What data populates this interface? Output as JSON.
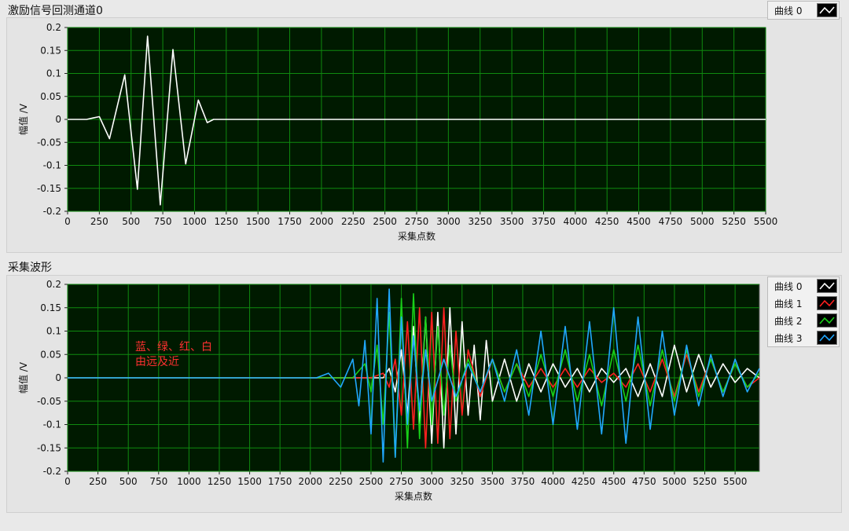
{
  "chart_data": [
    {
      "type": "line",
      "title": "激励信号回测通道0",
      "xlabel": "采集点数",
      "ylabel": "幅值 /V",
      "xlim": [
        0,
        5500
      ],
      "ylim": [
        -0.2,
        0.2
      ],
      "xticks": [
        0,
        250,
        500,
        750,
        1000,
        1250,
        1500,
        1750,
        2000,
        2250,
        2500,
        2750,
        3000,
        3250,
        3500,
        3750,
        4000,
        4250,
        4500,
        4750,
        5000,
        5250,
        5500
      ],
      "yticks": [
        0.2,
        0.15,
        0.1,
        0.05,
        0,
        -0.05,
        -0.1,
        -0.15,
        -0.2
      ],
      "grid": true,
      "legend": "top-right",
      "series": [
        {
          "name": "曲线 0",
          "color": "#ffffff",
          "x": [
            0,
            150,
            200,
            250,
            330,
            450,
            550,
            630,
            730,
            830,
            930,
            1030,
            1100,
            1150,
            1200,
            5500
          ],
          "y": [
            0,
            0,
            0.003,
            0.006,
            -0.042,
            0.097,
            -0.152,
            0.181,
            -0.186,
            0.152,
            -0.097,
            0.042,
            -0.007,
            0,
            0,
            0
          ]
        }
      ]
    },
    {
      "type": "line",
      "title": "采集波形",
      "xlabel": "采集点数",
      "ylabel": "幅值 /V",
      "xlim": [
        0,
        5700
      ],
      "ylim": [
        -0.2,
        0.2
      ],
      "xticks": [
        0,
        250,
        500,
        750,
        1000,
        1250,
        1500,
        1750,
        2000,
        2250,
        2500,
        2750,
        3000,
        3250,
        3500,
        3750,
        4000,
        4250,
        4500,
        4750,
        5000,
        5250,
        5500
      ],
      "yticks": [
        0.2,
        0.15,
        0.1,
        0.05,
        0,
        -0.05,
        -0.1,
        -0.15,
        -0.2
      ],
      "grid": true,
      "legend": "top-right",
      "annotation": [
        "蓝、绿、红、白",
        "由远及近"
      ],
      "annotation_color": "#ff3030",
      "series": [
        {
          "name": "曲线 0",
          "color": "#ffffff",
          "x": [
            0,
            2000,
            2600,
            2650,
            2700,
            2750,
            2800,
            2850,
            2900,
            2950,
            3000,
            3050,
            3100,
            3150,
            3200,
            3250,
            3300,
            3350,
            3400,
            3450,
            3500,
            3600,
            3700,
            3800,
            3900,
            4000,
            4100,
            4200,
            4300,
            4400,
            4500,
            4600,
            4700,
            4800,
            4900,
            5000,
            5100,
            5200,
            5300,
            5400,
            5500,
            5600,
            5700
          ],
          "y": [
            0,
            0,
            0,
            0.02,
            -0.03,
            0.06,
            -0.08,
            0.11,
            -0.1,
            0.13,
            -0.14,
            0.14,
            -0.15,
            0.15,
            -0.12,
            0.12,
            -0.08,
            0.07,
            -0.09,
            0.08,
            -0.05,
            0.04,
            -0.05,
            0.03,
            -0.03,
            0.03,
            -0.02,
            0.02,
            -0.03,
            0.02,
            -0.01,
            0.02,
            -0.04,
            0.03,
            -0.04,
            0.07,
            -0.03,
            0.05,
            -0.02,
            0.03,
            -0.01,
            0.02,
            0
          ]
        },
        {
          "name": "曲线 1",
          "color": "#ff2020",
          "x": [
            0,
            2200,
            2500,
            2600,
            2650,
            2700,
            2750,
            2800,
            2850,
            2900,
            2950,
            3000,
            3050,
            3100,
            3150,
            3200,
            3250,
            3300,
            3400,
            3500,
            3600,
            3700,
            3800,
            3900,
            4000,
            4100,
            4200,
            4300,
            4400,
            4500,
            4600,
            4700,
            4800,
            4900,
            5000,
            5100,
            5200,
            5300,
            5400,
            5500,
            5600,
            5700
          ],
          "y": [
            0,
            0,
            0,
            0.01,
            -0.02,
            0.04,
            -0.08,
            0.12,
            -0.11,
            0.15,
            -0.15,
            0.14,
            -0.14,
            0.15,
            -0.13,
            0.1,
            -0.08,
            0.06,
            -0.04,
            0.04,
            -0.03,
            0.03,
            -0.02,
            0.02,
            -0.02,
            0.02,
            -0.02,
            0.02,
            -0.01,
            0.01,
            -0.02,
            0.03,
            -0.03,
            0.04,
            -0.04,
            0.05,
            -0.03,
            0.04,
            -0.03,
            0.03,
            -0.02,
            0
          ]
        },
        {
          "name": "曲线 2",
          "color": "#18d018",
          "x": [
            0,
            2100,
            2350,
            2450,
            2500,
            2550,
            2600,
            2650,
            2700,
            2750,
            2800,
            2850,
            2900,
            2950,
            3000,
            3050,
            3100,
            3150,
            3200,
            3300,
            3400,
            3500,
            3600,
            3700,
            3800,
            3900,
            4000,
            4100,
            4200,
            4300,
            4400,
            4500,
            4600,
            4700,
            4800,
            4900,
            5000,
            5100,
            5200,
            5300,
            5400,
            5500,
            5600,
            5700
          ],
          "y": [
            0,
            0,
            0,
            0.03,
            -0.03,
            0.07,
            -0.1,
            0.14,
            -0.17,
            0.17,
            -0.15,
            0.18,
            -0.13,
            0.13,
            -0.1,
            0.11,
            -0.08,
            0.07,
            -0.05,
            0.04,
            -0.03,
            0.04,
            -0.03,
            0.03,
            -0.04,
            0.05,
            -0.04,
            0.06,
            -0.05,
            0.05,
            -0.06,
            0.06,
            -0.05,
            0.07,
            -0.06,
            0.06,
            -0.05,
            0.06,
            -0.04,
            0.04,
            -0.03,
            0.03,
            -0.02,
            0.01
          ]
        },
        {
          "name": "曲线 3",
          "color": "#20a8ff",
          "x": [
            0,
            2050,
            2150,
            2250,
            2350,
            2400,
            2450,
            2500,
            2550,
            2600,
            2650,
            2700,
            2750,
            2800,
            2850,
            2900,
            2950,
            3000,
            3100,
            3200,
            3300,
            3400,
            3500,
            3600,
            3700,
            3800,
            3900,
            4000,
            4100,
            4200,
            4300,
            4400,
            4500,
            4600,
            4700,
            4800,
            4900,
            5000,
            5100,
            5200,
            5300,
            5400,
            5500,
            5600,
            5700
          ],
          "y": [
            0,
            0,
            0.01,
            -0.02,
            0.04,
            -0.06,
            0.08,
            -0.12,
            0.17,
            -0.18,
            0.19,
            -0.17,
            0.13,
            -0.1,
            0.09,
            -0.07,
            0.06,
            -0.05,
            0.04,
            -0.04,
            0.03,
            -0.03,
            0.04,
            -0.05,
            0.06,
            -0.08,
            0.1,
            -0.1,
            0.11,
            -0.11,
            0.12,
            -0.12,
            0.15,
            -0.14,
            0.13,
            -0.11,
            0.1,
            -0.08,
            0.07,
            -0.06,
            0.05,
            -0.04,
            0.04,
            -0.03,
            0.02
          ]
        }
      ]
    }
  ]
}
